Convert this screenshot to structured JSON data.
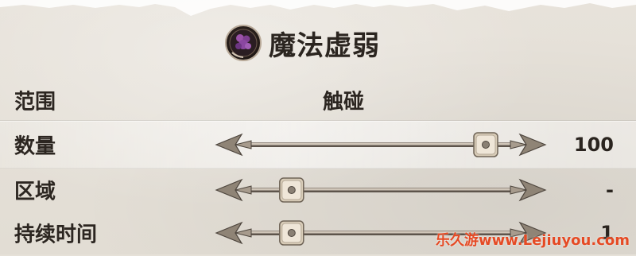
{
  "title": "魔法虚弱",
  "icon": "spell-curse-icon",
  "rows": [
    {
      "label": "范围",
      "value": "触碰"
    },
    {
      "label": "数量",
      "value": "100",
      "slider_fraction": 0.9
    },
    {
      "label": "区域",
      "value": "-",
      "slider_fraction": 0.16
    },
    {
      "label": "持续时间",
      "value": "1",
      "slider_fraction": 0.16
    }
  ],
  "watermark": "乐久游www.Lejiuyou.com",
  "colors": {
    "background": "#e6e1d8",
    "text": "#2c2621",
    "slider_metal": "#8f8476",
    "spell_icon": "#7a3a86",
    "watermark": "#e54a24"
  }
}
